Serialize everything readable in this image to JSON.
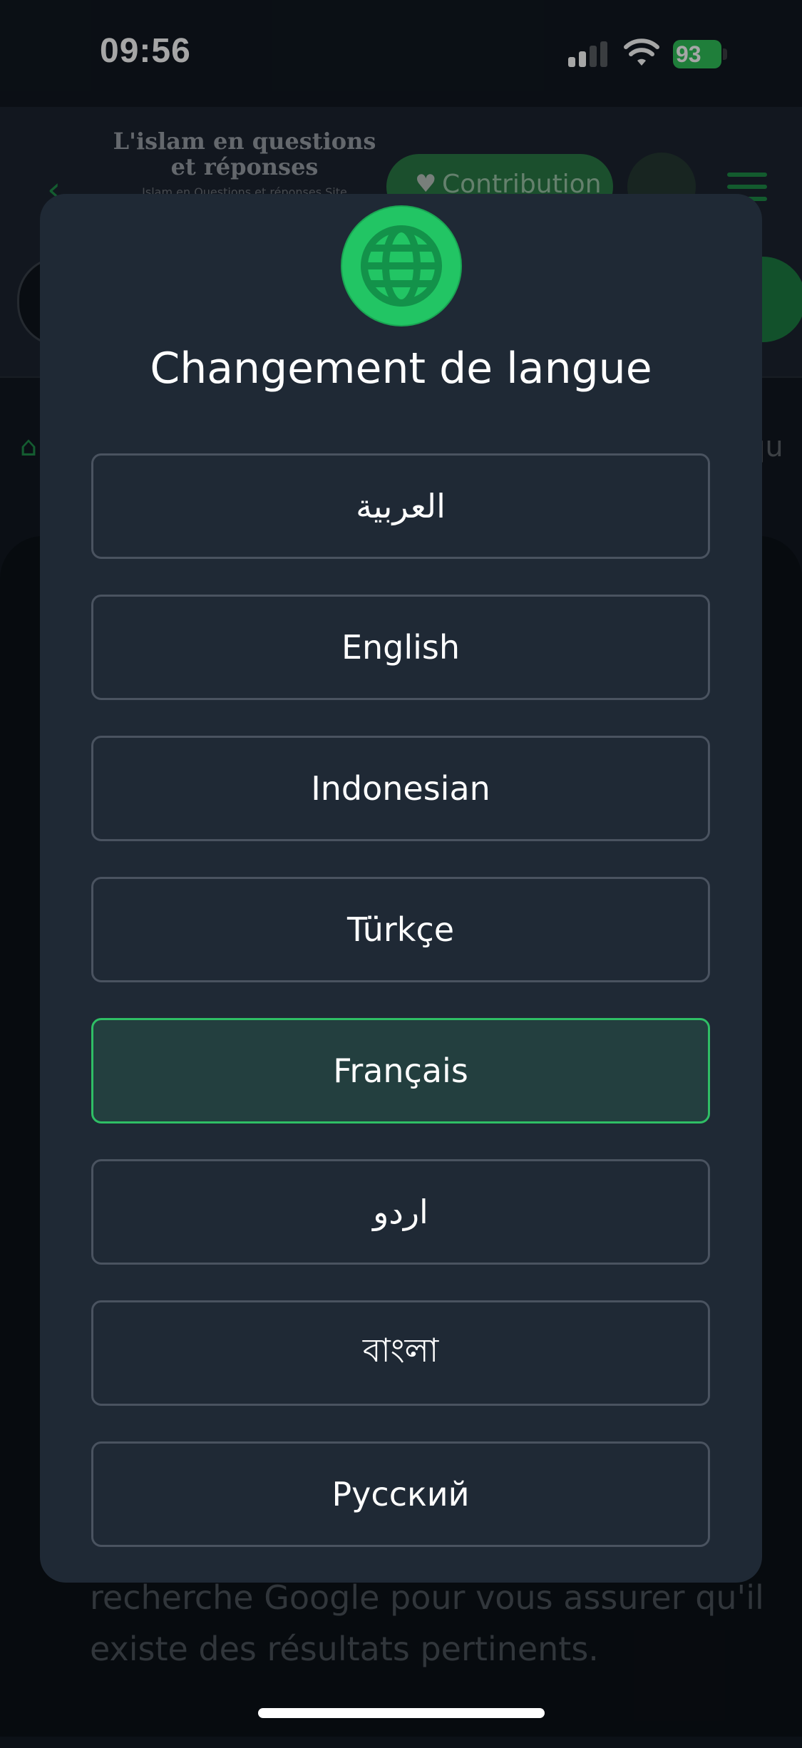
{
  "status_bar": {
    "time": "09:56",
    "battery_percent": "93"
  },
  "header": {
    "site_title": "L'islam en questions et réponses",
    "site_subtitle": "Islam en Questions et réponses Site",
    "contribution_label": "Contribution"
  },
  "breadcrumb": {
    "tail_text": "qu"
  },
  "body": {
    "text": "recherche Google pour vous assurer qu'il existe des résultats pertinents."
  },
  "modal": {
    "title": "Changement de langue",
    "icon": "globe-icon",
    "selected_language": "Français",
    "languages": [
      {
        "label": "العربية"
      },
      {
        "label": "English"
      },
      {
        "label": "Indonesian"
      },
      {
        "label": "Türkçe"
      },
      {
        "label": "Français"
      },
      {
        "label": "اردو"
      },
      {
        "label": "বাংলা"
      },
      {
        "label": "Русский"
      }
    ]
  },
  "colors": {
    "accent_green": "#2fbe65",
    "modal_background": "#1f2935",
    "selected_background": "#233f3f"
  }
}
